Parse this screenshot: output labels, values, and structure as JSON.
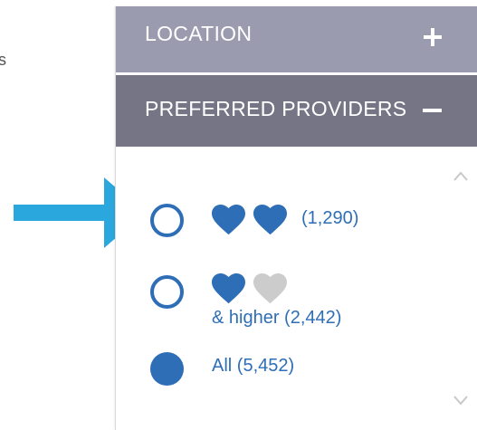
{
  "page": {
    "edge_text": "s"
  },
  "filters": {
    "location": {
      "label": "LOCATION",
      "toggle_icon": "plus-icon"
    },
    "preferred_providers": {
      "label": "PREFERRED PROVIDERS",
      "toggle_icon": "minus-icon"
    }
  },
  "options": [
    {
      "hearts_filled": 2,
      "hearts_total": 2,
      "count_text": "(1,290)",
      "selected": false
    },
    {
      "hearts_filled": 1,
      "hearts_total": 2,
      "count_text": "& higher (2,442)",
      "selected": false
    },
    {
      "label": "All (5,452)",
      "selected": true
    }
  ],
  "colors": {
    "accent": "#2e6eb7",
    "arrow": "#2aa7dd",
    "heart_empty": "#cccccc",
    "header_collapsed": "#9b9baf",
    "header_expanded": "#767586"
  }
}
